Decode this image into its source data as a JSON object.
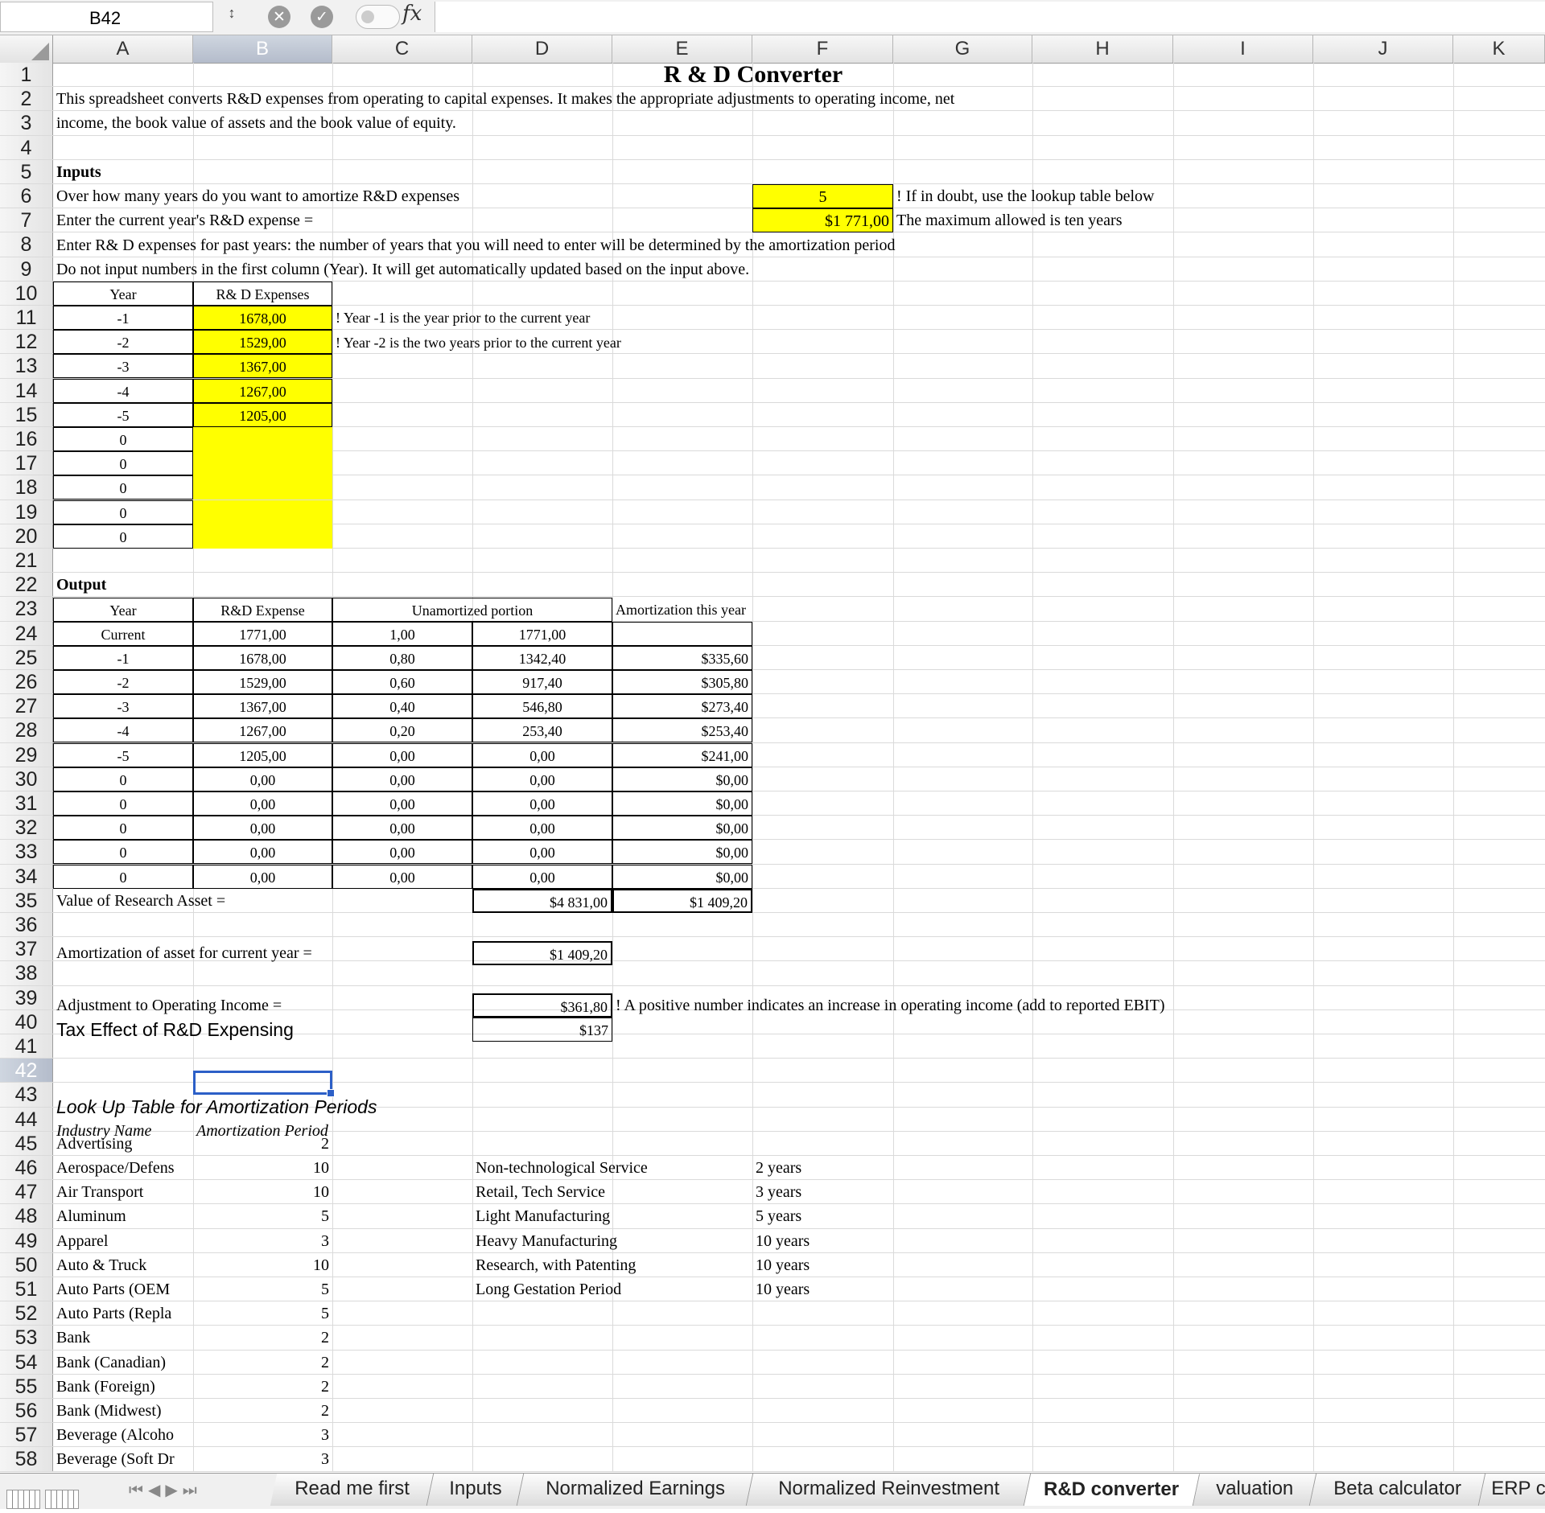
{
  "formula_bar": {
    "name_box": "B42",
    "fx": "fx",
    "formula": ""
  },
  "columns": [
    "A",
    "B",
    "C",
    "D",
    "E",
    "F",
    "G",
    "H",
    "I",
    "J",
    "K"
  ],
  "row_numbers": [
    "1",
    "2",
    "3",
    "4",
    "5",
    "6",
    "7",
    "8",
    "9",
    "10",
    "11",
    "12",
    "13",
    "14",
    "15",
    "16",
    "17",
    "18",
    "19",
    "20",
    "21",
    "22",
    "23",
    "24",
    "25",
    "26",
    "27",
    "28",
    "29",
    "30",
    "31",
    "32",
    "33",
    "34",
    "35",
    "36",
    "37",
    "38",
    "39",
    "40",
    "41",
    "42",
    "43",
    "44",
    "45",
    "46",
    "47",
    "48",
    "49",
    "50",
    "51",
    "52",
    "53",
    "54",
    "55",
    "56",
    "57",
    "58"
  ],
  "sheet": {
    "title": "R & D Converter",
    "desc1": "This spreadsheet converts R&D expenses from operating to capital expenses. It makes the appropriate adjustments to operating income, net",
    "desc2": "income, the book value of assets and the book value of equity.",
    "inputs_heading": "Inputs",
    "q_years": "Over how many years do you want to amortize R&D expenses",
    "years_value": "5",
    "years_note": "! If in doubt, use the lookup table below",
    "q_current": "Enter the current year's R&D expense =",
    "current_value": "$1 771,00",
    "current_note": "The maximum allowed is ten years",
    "instr_past": "Enter R& D expenses for past years: the number of years that you will need to enter will be determined by the amortization period",
    "instr_col": "Do not input numbers in the first column (Year). It will get automatically updated  based on the input above.",
    "input_table": {
      "header_year": "Year",
      "header_exp": "R& D Expenses",
      "rows": [
        {
          "year": "-1",
          "exp": "1678,00"
        },
        {
          "year": "-2",
          "exp": "1529,00"
        },
        {
          "year": "-3",
          "exp": "1367,00"
        },
        {
          "year": "-4",
          "exp": "1267,00"
        },
        {
          "year": "-5",
          "exp": "1205,00"
        },
        {
          "year": "0",
          "exp": ""
        },
        {
          "year": "0",
          "exp": ""
        },
        {
          "year": "0",
          "exp": ""
        },
        {
          "year": "0",
          "exp": ""
        },
        {
          "year": "0",
          "exp": ""
        }
      ],
      "note1": "! Year -1 is the year prior to the current year",
      "note2": "! Year -2 is the two years prior to the current year"
    },
    "output_heading": "Output",
    "output_table": {
      "header_year": "Year",
      "header_exp": "R&D Expense",
      "header_unam": "Unamortized portion",
      "header_amort": "Amortization this year",
      "rows": [
        {
          "year": "Current",
          "exp": "1771,00",
          "frac": "1,00",
          "unam": "1771,00",
          "amort": ""
        },
        {
          "year": "-1",
          "exp": "1678,00",
          "frac": "0,80",
          "unam": "1342,40",
          "amort": "$335,60"
        },
        {
          "year": "-2",
          "exp": "1529,00",
          "frac": "0,60",
          "unam": "917,40",
          "amort": "$305,80"
        },
        {
          "year": "-3",
          "exp": "1367,00",
          "frac": "0,40",
          "unam": "546,80",
          "amort": "$273,40"
        },
        {
          "year": "-4",
          "exp": "1267,00",
          "frac": "0,20",
          "unam": "253,40",
          "amort": "$253,40"
        },
        {
          "year": "-5",
          "exp": "1205,00",
          "frac": "0,00",
          "unam": "0,00",
          "amort": "$241,00"
        },
        {
          "year": "0",
          "exp": "0,00",
          "frac": "0,00",
          "unam": "0,00",
          "amort": "$0,00"
        },
        {
          "year": "0",
          "exp": "0,00",
          "frac": "0,00",
          "unam": "0,00",
          "amort": "$0,00"
        },
        {
          "year": "0",
          "exp": "0,00",
          "frac": "0,00",
          "unam": "0,00",
          "amort": "$0,00"
        },
        {
          "year": "0",
          "exp": "0,00",
          "frac": "0,00",
          "unam": "0,00",
          "amort": "$0,00"
        },
        {
          "year": "0",
          "exp": "0,00",
          "frac": "0,00",
          "unam": "0,00",
          "amort": "$0,00"
        }
      ]
    },
    "research_asset_label": "Value of Research Asset =",
    "research_asset_value": "$4 831,00",
    "research_asset_amort": "$1 409,20",
    "amort_label": "Amortization of asset for current year =",
    "amort_value": "$1 409,20",
    "adj_label": "Adjustment to Operating Income =",
    "adj_value": "$361,80",
    "adj_note": "! A positive number indicates an increase in operating income (add to reported EBIT)",
    "tax_label": "Tax Effect of R&D Expensing",
    "tax_value": "$137",
    "lookup_title": "Look Up Table for Amortization Periods",
    "lookup_h_industry": "Industry Name",
    "lookup_h_period": "Amortization Period",
    "lookup_rows": [
      {
        "name": "Advertising",
        "period": "2"
      },
      {
        "name": "Aerospace/Defens",
        "period": "10"
      },
      {
        "name": "Air Transport",
        "period": "10"
      },
      {
        "name": "Aluminum",
        "period": "5"
      },
      {
        "name": "Apparel",
        "period": "3"
      },
      {
        "name": "Auto & Truck",
        "period": "10"
      },
      {
        "name": "Auto Parts (OEM",
        "period": "5"
      },
      {
        "name": "Auto Parts (Repla",
        "period": "5"
      },
      {
        "name": "Bank",
        "period": "2"
      },
      {
        "name": "Bank (Canadian)",
        "period": "2"
      },
      {
        "name": "Bank (Foreign)",
        "period": "2"
      },
      {
        "name": "Bank (Midwest)",
        "period": "2"
      },
      {
        "name": "Beverage (Alcoho",
        "period": "3"
      },
      {
        "name": "Beverage (Soft Dr",
        "period": "3"
      }
    ],
    "guide_rows": [
      {
        "type": "Non-technological Service",
        "years": "2 years"
      },
      {
        "type": "Retail, Tech Service",
        "years": "3 years"
      },
      {
        "type": "Light Manufacturing",
        "years": "5 years"
      },
      {
        "type": "Heavy  Manufacturing",
        "years": "10 years"
      },
      {
        "type": "Research, with Patenting",
        "years": "10 years"
      },
      {
        "type": "Long Gestation Period",
        "years": "10 years"
      }
    ]
  },
  "tabs": [
    "Read me first",
    "Inputs",
    "Normalized Earnings",
    "Normalized Reinvestment",
    "R&D converter",
    "valuation",
    "Beta calculator",
    "ERP c"
  ],
  "active_tab": "R&D converter",
  "colors": {
    "input_fill": "#ffff00",
    "selection": "#2c5fc7"
  }
}
